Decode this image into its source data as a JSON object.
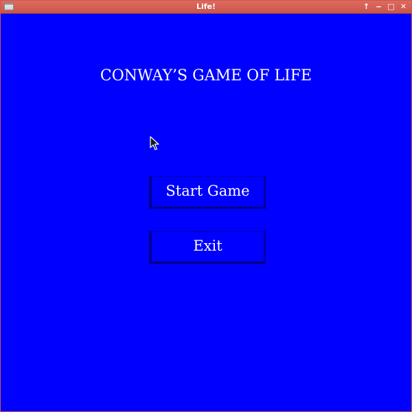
{
  "window": {
    "title": "Life!",
    "controls": [
      "↑",
      "‒",
      "□",
      "✕"
    ]
  },
  "main": {
    "title": "CONWAY’S GAME OF LIFE",
    "buttons": {
      "start": "Start Game",
      "exit": "Exit"
    }
  },
  "colors": {
    "background": "#0000ff",
    "titlebar": "#d75d53",
    "text": "#ffffff"
  },
  "icons": {
    "app": "window-icon",
    "cursor": "mouse-pointer-icon"
  }
}
